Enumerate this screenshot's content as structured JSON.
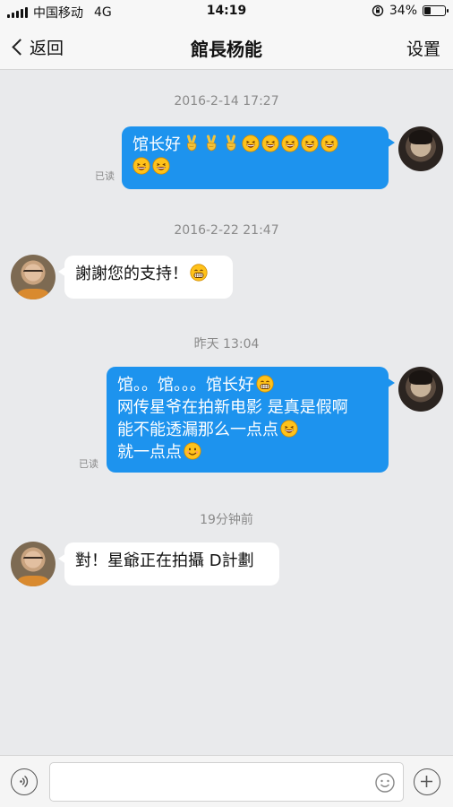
{
  "status_bar": {
    "carrier": "中国移动",
    "network": "4G",
    "time": "14:19",
    "battery": "34%",
    "battery_level": 0.34
  },
  "nav": {
    "back_label": "返回",
    "title": "館長杨能",
    "settings_label": "设置"
  },
  "messages": [
    {
      "timestamp": "2016-2-14 17:27",
      "sender": "self",
      "read": "已读",
      "lines": [
        "馆长好"
      ],
      "emoji_note": "victory-hand x3, grinning-face x7"
    },
    {
      "timestamp": "2016-2-22 21:47",
      "sender": "other",
      "lines": [
        "謝謝您的支持！"
      ]
    },
    {
      "timestamp": "昨天 13:04",
      "sender": "self",
      "read": "已读",
      "lines": [
        "馆。。馆。。。馆长好",
        "网传星爷在拍新电影 是真是假啊",
        "能不能透漏那么一点点",
        "就一点点"
      ]
    },
    {
      "timestamp": "19分钟前",
      "sender": "other",
      "lines": [
        "對！星爺正在拍攝 D計劃"
      ]
    }
  ],
  "colors": {
    "self_bubble": "#1d93ee",
    "other_bubble": "#ffffff",
    "background": "#e9eaec",
    "emoji_yellow": "#ffc21a"
  },
  "input": {
    "value": "",
    "placeholder": ""
  }
}
